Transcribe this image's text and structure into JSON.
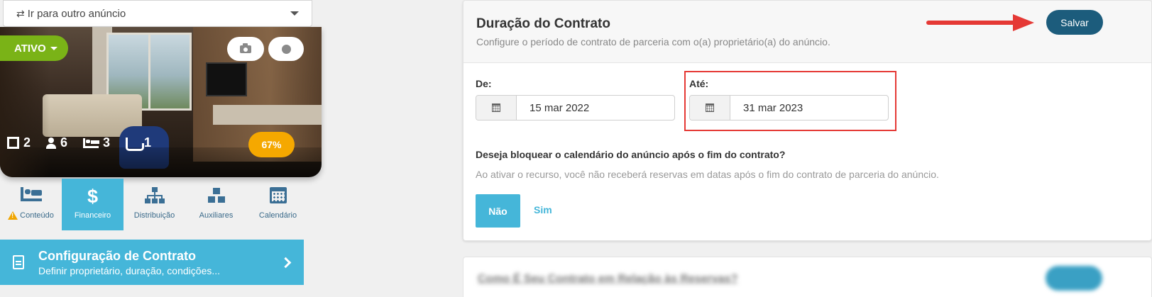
{
  "left": {
    "ad_select": {
      "icon": "swap-icon",
      "label": "Ir para outro anúncio"
    },
    "status": {
      "label": "ATIVO"
    },
    "stats": {
      "units": "2",
      "guests": "6",
      "bedrooms": "3",
      "bathrooms": "1"
    },
    "score": "67%",
    "tabs": [
      {
        "label": "Conteúdo",
        "icon": "bed-icon",
        "warning": true
      },
      {
        "label": "Financeiro",
        "icon": "dollar-icon",
        "active": true
      },
      {
        "label": "Distribuição",
        "icon": "sitemap-icon"
      },
      {
        "label": "Auxiliares",
        "icon": "cubes-icon"
      },
      {
        "label": "Calendário",
        "icon": "calendar-icon"
      }
    ],
    "config": {
      "title": "Configuração de Contrato",
      "subtitle": "Definir proprietário, duração, condições..."
    }
  },
  "card": {
    "title": "Duração do Contrato",
    "subtitle": "Configure o período de contrato de parceria com o(a) proprietário(a) do anúncio.",
    "save_label": "Salvar",
    "from_label": "De:",
    "from_value": "15 mar 2022",
    "to_label": "Até:",
    "to_value": "31 mar 2023",
    "question": "Deseja bloquear o calendário do anúncio após o fim do contrato?",
    "question_desc": "Ao ativar o recurso, você não receberá reservas em datas após o fim do contrato de parceria do anúncio.",
    "no_label": "Não",
    "yes_label": "Sim"
  },
  "blurred_card": {
    "title": "Como É Seu Contrato em Relação às Reservas?"
  },
  "colors": {
    "accent": "#45b6d9",
    "save_button": "#1c5c7c",
    "status_green": "#7ab317",
    "score_orange": "#f5a800",
    "annotation_red": "#e53935"
  }
}
